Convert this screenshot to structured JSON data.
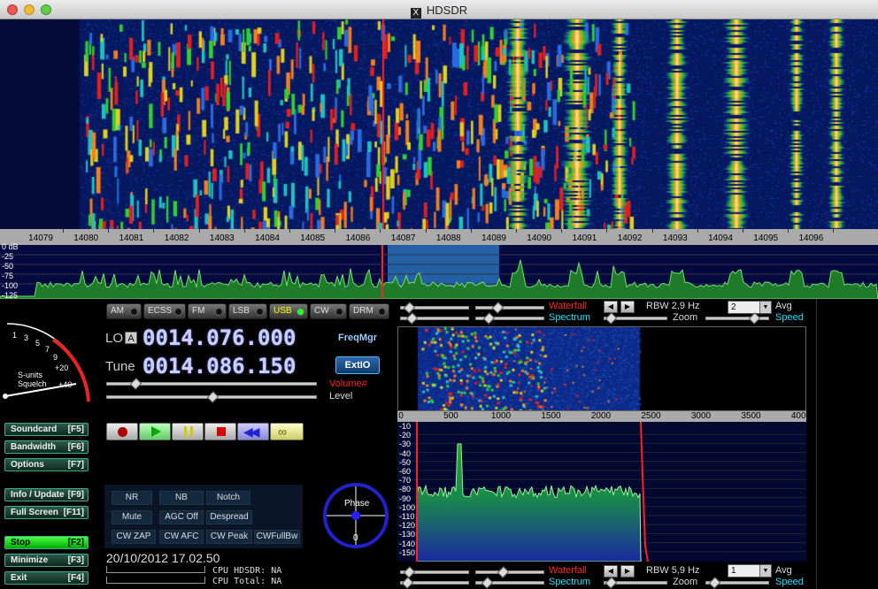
{
  "window": {
    "title": "HDSDR"
  },
  "main_ruler": [
    "14079",
    "14080",
    "14081",
    "14082",
    "14083",
    "14084",
    "14085",
    "14086",
    "14087",
    "14088",
    "14089",
    "14090",
    "14091",
    "14092",
    "14093",
    "14094",
    "14095",
    "14096"
  ],
  "main_db_scale": [
    "0 dB",
    "-25",
    "-50",
    "-75",
    "-100",
    "-125"
  ],
  "modes": [
    {
      "label": "AM",
      "active": false
    },
    {
      "label": "ECSS",
      "active": false
    },
    {
      "label": "FM",
      "active": false
    },
    {
      "label": "LSB",
      "active": false
    },
    {
      "label": "USB",
      "active": true
    },
    {
      "label": "CW",
      "active": false
    },
    {
      "label": "DRM",
      "active": false
    }
  ],
  "smeter": {
    "scale": [
      "1",
      "3",
      "5",
      "7",
      "9",
      "+20",
      "+40"
    ],
    "label_top": "S-units",
    "label_bottom": "Squelch"
  },
  "lo": {
    "label": "LO",
    "badge": "A",
    "value": "0014.076.000"
  },
  "tune": {
    "label": "Tune",
    "value": "0014.086.150"
  },
  "freqmgr_label": "FreqMgr",
  "extio_label": "ExtIO",
  "volume_label": "Volume#",
  "volume_level": 0.12,
  "level_label": "Level",
  "level_level": 0.5,
  "side_buttons": [
    {
      "label": "Soundcard",
      "key": "[F5]",
      "active": false
    },
    {
      "label": "Bandwidth",
      "key": "[F6]",
      "active": false
    },
    {
      "label": "Options",
      "key": "[F7]",
      "active": false
    },
    {
      "label": "Info / Update",
      "key": "[F9]",
      "active": false
    },
    {
      "label": "Full Screen",
      "key": "[F11]",
      "active": false
    },
    {
      "label": "Stop",
      "key": "[F2]",
      "active": true
    },
    {
      "label": "Minimize",
      "key": "[F3]",
      "active": false
    },
    {
      "label": "Exit",
      "key": "[F4]",
      "active": false
    }
  ],
  "dsp_buttons": [
    "NR",
    "NB",
    "Notch",
    "Mute",
    "AGC Off",
    "Despread",
    "CW ZAP",
    "CW AFC",
    "CW Peak",
    "CWFullBw"
  ],
  "phase": {
    "label": "Phase",
    "value": "0"
  },
  "datetime": "20/10/2012 17.02.50",
  "cpu": {
    "hdsdr": "CPU HDSDR: NA",
    "total": "CPU Total:  NA"
  },
  "ctrl_top": {
    "waterfall": "Waterfall",
    "spectrum": "Spectrum",
    "rbw": "RBW  2,9 Hz",
    "zoom": "Zoom",
    "avg_value": "2",
    "avg": "Avg",
    "speed": "Speed"
  },
  "ctrl_bottom": {
    "waterfall": "Waterfall",
    "spectrum": "Spectrum",
    "rbw": "RBW  5,9 Hz",
    "zoom": "Zoom",
    "avg_value": "1",
    "avg": "Avg",
    "speed": "Speed"
  },
  "audio_ruler": [
    "0",
    "500",
    "1000",
    "1500",
    "2000",
    "2500",
    "3000",
    "3500",
    "4000"
  ],
  "audio_db": [
    "-10",
    "-20",
    "-30",
    "-40",
    "-50",
    "-60",
    "-70",
    "-80",
    "-90",
    "-100",
    "-110",
    "-120",
    "-130",
    "-140",
    "-150"
  ],
  "colors": {
    "label_red": "#ff2020",
    "label_cyan": "#20e0ff",
    "lcd": "#c8d0ff",
    "side_btn": "#1e4a3c"
  }
}
